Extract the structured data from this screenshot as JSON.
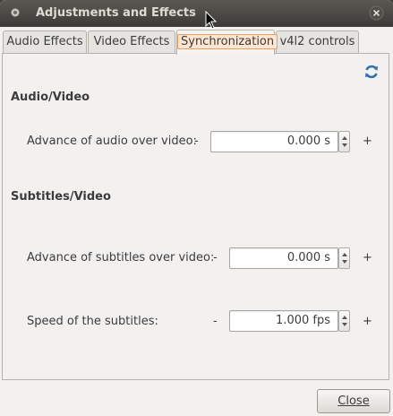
{
  "window": {
    "title": "Adjustments and Effects"
  },
  "tabs": [
    {
      "label": "Audio Effects"
    },
    {
      "label": "Video Effects"
    },
    {
      "label": "Synchronization"
    },
    {
      "label": "v4l2 controls"
    }
  ],
  "active_tab": "Synchronization",
  "audio_video": {
    "heading": "Audio/Video",
    "advance_label": "Advance of audio over video:",
    "minus": "-",
    "plus": "+",
    "value": "0.000 s"
  },
  "subtitles_video": {
    "heading": "Subtitles/Video",
    "advance_label": "Advance of subtitles over video:",
    "advance_minus": "-",
    "advance_plus": "+",
    "advance_value": "0.000 s",
    "speed_label": "Speed of the subtitles:",
    "speed_minus": "-",
    "speed_plus": "+",
    "speed_value": "1.000 fps"
  },
  "buttons": {
    "close": "Close"
  },
  "icons": {
    "refresh": "refresh-icon",
    "window_close": "close-icon"
  },
  "colors": {
    "titlebar": "#3c3b37",
    "accent": "#e8a060",
    "refresh": "#2f6fb0"
  }
}
